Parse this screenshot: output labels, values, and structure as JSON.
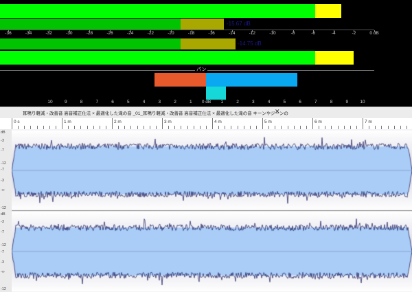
{
  "meters": {
    "db_ticks": [
      "-36",
      "-34",
      "-32",
      "-30",
      "-28",
      "-26",
      "-24",
      "-22",
      "-20",
      "-18",
      "-16",
      "-14",
      "-12",
      "-10",
      "-8",
      "-6",
      "-4",
      "-2",
      "0 dB"
    ],
    "readout_left": "-15.67 dB",
    "readout_right": "-14.75 dB",
    "pan_label": "パン",
    "pan_ticks": [
      "10",
      "9",
      "8",
      "7",
      "6",
      "5",
      "4",
      "3",
      "2",
      "1",
      "0 dB",
      "1",
      "2",
      "3",
      "4",
      "5",
      "6",
      "7",
      "8",
      "9",
      "10"
    ],
    "colors": {
      "green": "#00ff00",
      "dark_green": "#00c400",
      "olive": "#a8a800",
      "yellow": "#ffff00",
      "pan_left": "#e85a2c",
      "pan_right": "#0aa8f0",
      "pan_center": "#17d8d8"
    }
  },
  "document": {
    "title": "耳鳴り軽減・改善音 高音補正仕法 × 最適化した滝の音 _01_耳鳴り軽減・改善音 高音補正仕法 × 最適化した滝の音 キーンやジーンの"
  },
  "ruler": {
    "labels": [
      "0 s",
      "1 m",
      "2 m",
      "3 m",
      "4 m",
      "5 m",
      "6 m",
      "7 m"
    ]
  },
  "amplitude_labels": [
    "dB",
    "-3",
    "-7",
    "-12",
    "-∞",
    "-12",
    "-7",
    "-3",
    "dB",
    "-3",
    "-7",
    "-12",
    "-∞",
    "-12",
    "-7",
    "-3"
  ]
}
